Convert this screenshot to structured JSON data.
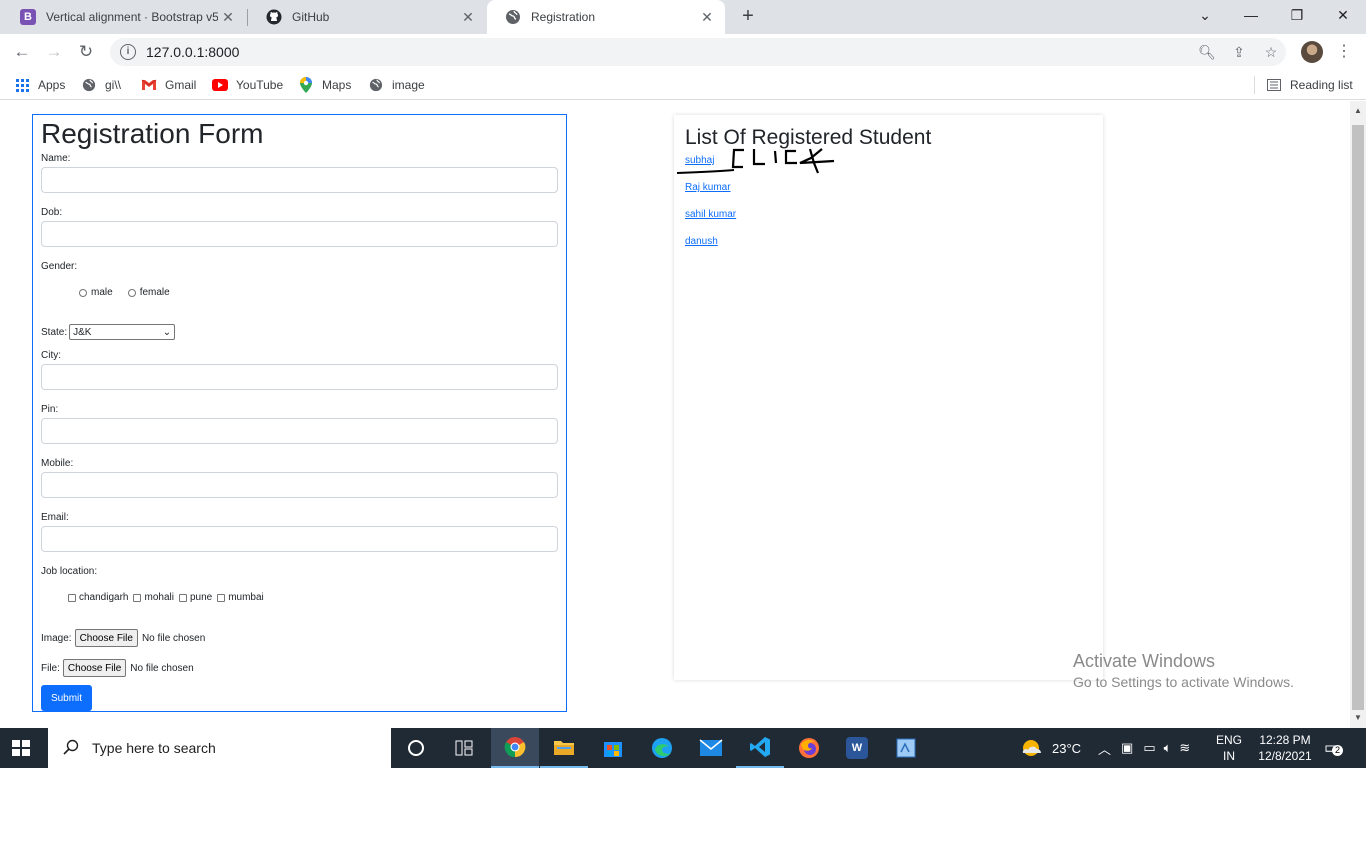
{
  "browser": {
    "tabs": [
      {
        "title": "Vertical alignment · Bootstrap v5.",
        "favicon": "B",
        "favicon_color": "#7952b3"
      },
      {
        "title": "GitHub",
        "favicon": "github-icon"
      },
      {
        "title": "Registration",
        "favicon": "globe-icon",
        "active": true
      }
    ],
    "new_tab": "+",
    "url": "127.0.0.1:8000",
    "bookmarks": [
      {
        "label": "Apps",
        "icon": "apps-grid-icon"
      },
      {
        "label": "gi\\\\",
        "icon": "globe-icon"
      },
      {
        "label": "Gmail",
        "icon": "gmail-icon"
      },
      {
        "label": "YouTube",
        "icon": "youtube-icon"
      },
      {
        "label": "Maps",
        "icon": "maps-icon"
      },
      {
        "label": "image",
        "icon": "globe-icon"
      }
    ],
    "reading_list": "Reading list"
  },
  "form": {
    "title": "Registration Form",
    "name_label": "Name:",
    "dob_label": "Dob:",
    "gender_label": "Gender:",
    "gender_options": [
      "male",
      "female"
    ],
    "state_label": "State:",
    "state_value": "J&K",
    "city_label": "City:",
    "pin_label": "Pin:",
    "mobile_label": "Mobile:",
    "email_label": "Email:",
    "job_location_label": "Job location:",
    "job_locations": [
      "chandigarh",
      "mohali",
      "pune",
      "mumbai"
    ],
    "image_label": "Image:",
    "file_label": "File:",
    "choose_file": "Choose File",
    "no_file": "No file chosen",
    "submit": "Submit"
  },
  "students": {
    "title": "List Of Registered Student",
    "items": [
      "subhaj",
      "Raj kumar",
      "sahil kumar",
      "danush"
    ],
    "annotation": "CLICK"
  },
  "watermark": {
    "line1": "Activate Windows",
    "line2": "Go to Settings to activate Windows."
  },
  "taskbar": {
    "search_placeholder": "Type here to search",
    "temperature": "23°C",
    "lang_top": "ENG",
    "lang_bottom": "IN",
    "time": "12:28 PM",
    "date": "12/8/2021",
    "notifications": "2"
  },
  "colors": {
    "primary": "#0d6efd",
    "taskbar": "#202a35",
    "tabstrip": "#dee1e6"
  }
}
